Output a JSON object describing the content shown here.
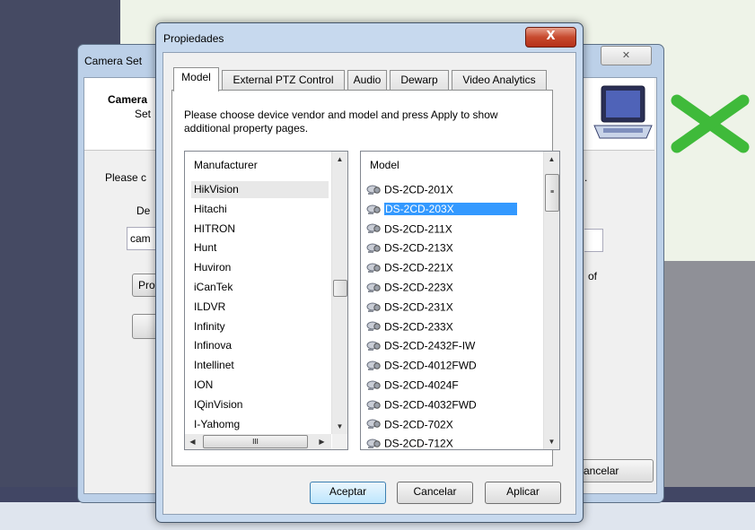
{
  "camera_setup": {
    "title": "Camera Set",
    "header_title": "Camera",
    "header_sub": "Set",
    "please_text": "Please c",
    "label_de": "De",
    "input_value": "cam",
    "button_pro": "Pro",
    "right_dot_1": ".",
    "right_dot_2": ".",
    "right_text_of": "of",
    "cancel_label": "ancelar"
  },
  "dialog": {
    "title": "Propiedades",
    "close_label": "X",
    "tabs": [
      {
        "label": "Model"
      },
      {
        "label": "External PTZ Control"
      },
      {
        "label": "Audio"
      },
      {
        "label": "Dewarp"
      },
      {
        "label": "Video Analytics"
      }
    ],
    "instructions": "Please choose device vendor and model and press Apply to show additional property pages.",
    "manufacturer_header": "Manufacturer",
    "manufacturers": [
      "HikVision",
      "Hitachi",
      "HITRON",
      "Hunt",
      "Huviron",
      "iCanTek",
      "ILDVR",
      "Infinity",
      "Infinova",
      "Intellinet",
      "ION",
      "IQinVision",
      "I-Yahomg"
    ],
    "selected_manufacturer": "HikVision",
    "model_header": "Model",
    "models": [
      "DS-2CD-201X",
      "DS-2CD-203X",
      "DS-2CD-211X",
      "DS-2CD-213X",
      "DS-2CD-221X",
      "DS-2CD-223X",
      "DS-2CD-231X",
      "DS-2CD-233X",
      "DS-2CD-2432F-IW",
      "DS-2CD-4012FWD",
      "DS-2CD-4024F",
      "DS-2CD-4032FWD",
      "DS-2CD-702X",
      "DS-2CD-712X"
    ],
    "selected_model": "DS-2CD-203X",
    "hscroll_grip": "III",
    "buttons": {
      "accept": "Aceptar",
      "cancel": "Cancelar",
      "apply": "Aplicar"
    }
  },
  "colors": {
    "selection": "#3399ff",
    "green_x": "#3fba3a",
    "title_bar": "#c7d9ee"
  }
}
